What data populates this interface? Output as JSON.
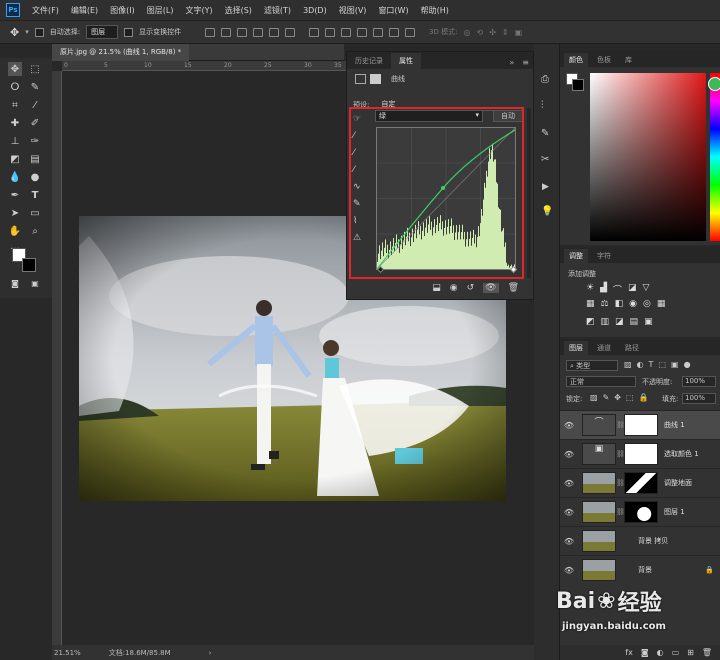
{
  "app": {
    "logo": "Ps"
  },
  "menu": [
    "文件(F)",
    "编辑(E)",
    "图像(I)",
    "图层(L)",
    "文字(Y)",
    "选择(S)",
    "滤镜(T)",
    "3D(D)",
    "视图(V)",
    "窗口(W)",
    "帮助(H)"
  ],
  "options": {
    "auto_select_label": "自动选择:",
    "auto_select_value": "图层",
    "show_transform_label": "显示变换控件",
    "mode_3d": "3D 模式:"
  },
  "document": {
    "tab_title": "原片.jpg @ 21.5% (曲线 1, RGB/8) *",
    "ruler_marks": [
      "0",
      "5",
      "10",
      "15",
      "20",
      "25",
      "30",
      "35"
    ]
  },
  "status": {
    "zoom": "21.51%",
    "doc_info": "文档:18.6M/85.8M"
  },
  "properties": {
    "tab_history": "历史记录",
    "tab_properties": "属性",
    "panel_name": "曲线",
    "preset_label": "预设:",
    "preset_value": "自定",
    "channel": "绿",
    "auto_button": "自动"
  },
  "color_panel": {
    "tab_color": "颜色",
    "tab_swatches": "色板",
    "tab_library": "库"
  },
  "adjust_panel": {
    "tab_adjust": "调整",
    "tab_char": "字符",
    "add_label": "添加调整"
  },
  "layers_panel": {
    "tab_layers": "图层",
    "tab_channels": "通道",
    "tab_paths": "路径",
    "filter_kind": "类型",
    "blend_mode": "正常",
    "opacity_label": "不透明度:",
    "opacity_value": "100%",
    "lock_label": "锁定:",
    "fill_label": "填充:",
    "fill_value": "100%",
    "layers": [
      {
        "name": "曲线 1",
        "selected": true
      },
      {
        "name": "选取颜色 1",
        "selected": false
      },
      {
        "name": "调整地面",
        "selected": false
      },
      {
        "name": "图层 1",
        "selected": false
      },
      {
        "name": "背景 拷贝",
        "selected": false
      },
      {
        "name": "背景",
        "selected": false
      }
    ]
  },
  "watermark": {
    "brand_a": "Bai",
    "brand_b": "经验",
    "url": "jingyan.baidu.com"
  },
  "colors": {
    "accent": "#e0262c",
    "curve": "#3fcf6a",
    "histogram": "#d8f6b8"
  }
}
